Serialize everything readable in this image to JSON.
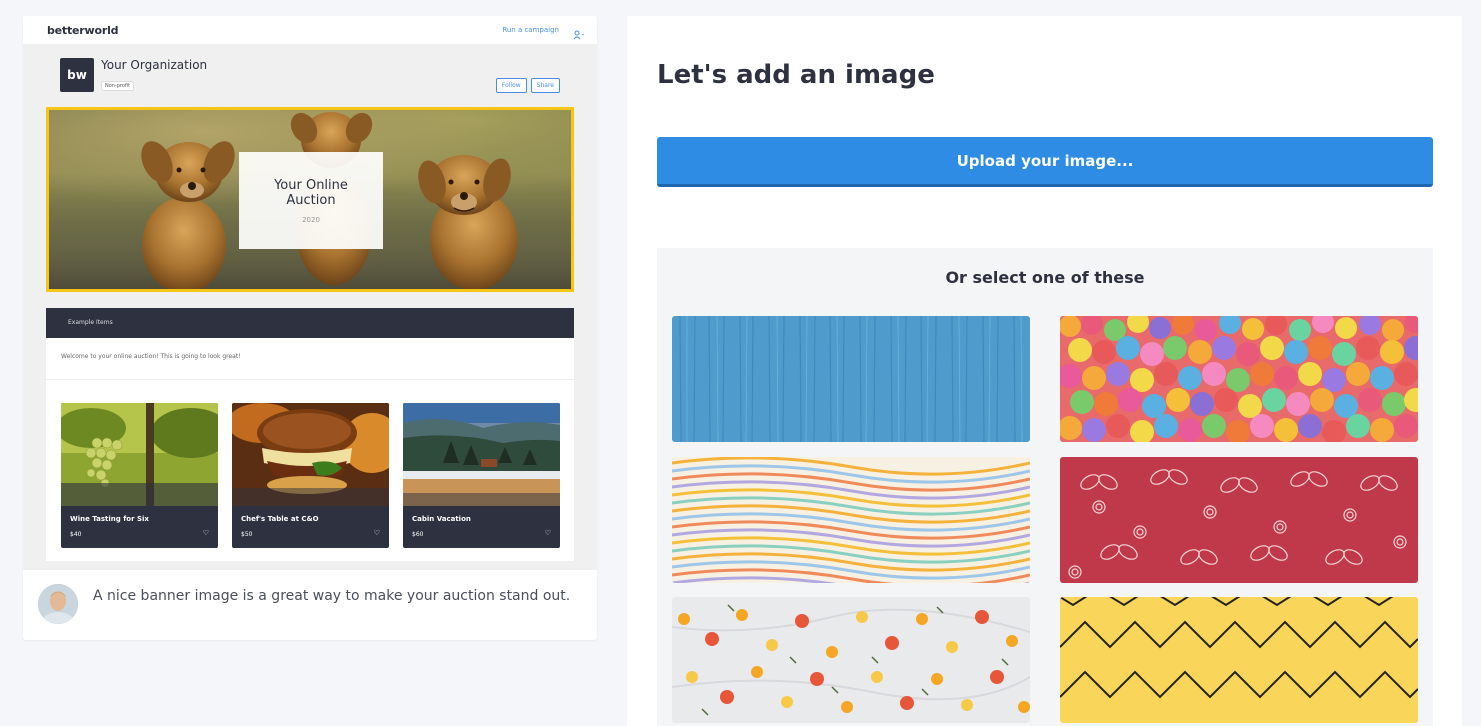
{
  "preview": {
    "brand": "betterworld",
    "run_campaign": "Run a campaign",
    "org_logo": "bw",
    "org_name": "Your Organization",
    "org_badge": "Non-profit",
    "follow_label": "Follow",
    "share_label": "Share",
    "banner_title": "Your Online Auction",
    "banner_year": "2020",
    "tab_label": "Example Items",
    "welcome_text": "Welcome to your online auction! This is going to look great!",
    "items": [
      {
        "title": "Wine Tasting for Six",
        "price": "$40"
      },
      {
        "title": "Chef's Table at C&O",
        "price": "$50"
      },
      {
        "title": "Cabin Vacation",
        "price": "$60"
      }
    ]
  },
  "tip": {
    "text": "A nice banner image is a great way to make your auction stand out."
  },
  "main": {
    "title": "Let's add an image",
    "upload_label": "Upload your image...",
    "select_title": "Or select one of these"
  },
  "colors": {
    "accent": "#2f8ce4",
    "dark": "#2d3140",
    "highlight": "#f5c518"
  }
}
